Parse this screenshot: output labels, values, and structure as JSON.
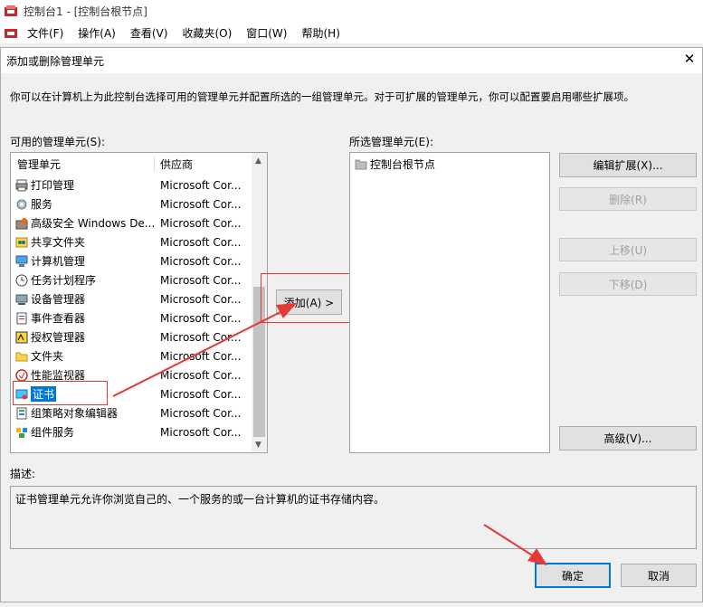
{
  "app": {
    "title": "控制台1 - [控制台根节点]",
    "menu": [
      "文件(F)",
      "操作(A)",
      "查看(V)",
      "收藏夹(O)",
      "窗口(W)",
      "帮助(H)"
    ]
  },
  "dialog": {
    "title": "添加或删除管理单元",
    "close_glyph": "✕",
    "intro": "你可以在计算机上为此控制台选择可用的管理单元并配置所选的一组管理单元。对于可扩展的管理单元，你可以配置要启用哪些扩展项。",
    "available_label": "可用的管理单元(S):",
    "col_snapin": "管理单元",
    "col_vendor": "供应商",
    "available": [
      {
        "name": "打印管理",
        "vendor": "Microsoft Cor...",
        "icon": "printer-icon"
      },
      {
        "name": "服务",
        "vendor": "Microsoft Cor...",
        "icon": "gears-icon"
      },
      {
        "name": "高级安全 Windows De...",
        "vendor": "Microsoft Cor...",
        "icon": "firewall-icon"
      },
      {
        "name": "共享文件夹",
        "vendor": "Microsoft Cor...",
        "icon": "shared-folder-icon"
      },
      {
        "name": "计算机管理",
        "vendor": "Microsoft Cor...",
        "icon": "computer-icon"
      },
      {
        "name": "任务计划程序",
        "vendor": "Microsoft Cor...",
        "icon": "clock-icon"
      },
      {
        "name": "设备管理器",
        "vendor": "Microsoft Cor...",
        "icon": "device-icon"
      },
      {
        "name": "事件查看器",
        "vendor": "Microsoft Cor...",
        "icon": "event-log-icon"
      },
      {
        "name": "授权管理器",
        "vendor": "Microsoft Cor...",
        "icon": "authorization-icon"
      },
      {
        "name": "文件夹",
        "vendor": "Microsoft Cor...",
        "icon": "folder-icon"
      },
      {
        "name": "性能监视器",
        "vendor": "Microsoft Cor...",
        "icon": "performance-icon"
      },
      {
        "name": "证书",
        "vendor": "Microsoft Cor...",
        "icon": "certificate-icon",
        "selected": true
      },
      {
        "name": "组策略对象编辑器",
        "vendor": "Microsoft Cor...",
        "icon": "policy-icon"
      },
      {
        "name": "组件服务",
        "vendor": "Microsoft Cor...",
        "icon": "component-icon"
      }
    ],
    "add_button": "添加(A) >",
    "selected_label": "所选管理单元(E):",
    "selected": [
      {
        "name": "控制台根节点",
        "icon": "folder-icon"
      }
    ],
    "edit_ext": "编辑扩展(X)...",
    "remove": "删除(R)",
    "move_up": "上移(U)",
    "move_down": "下移(D)",
    "advanced": "高级(V)...",
    "desc_label": "描述:",
    "description": "证书管理单元允许你浏览自己的、一个服务的或一台计算机的证书存储内容。",
    "ok": "确定",
    "cancel": "取消"
  },
  "colors": {
    "selection": "#0078d7",
    "annotation": "#e53935",
    "default_border": "#0078d7"
  }
}
